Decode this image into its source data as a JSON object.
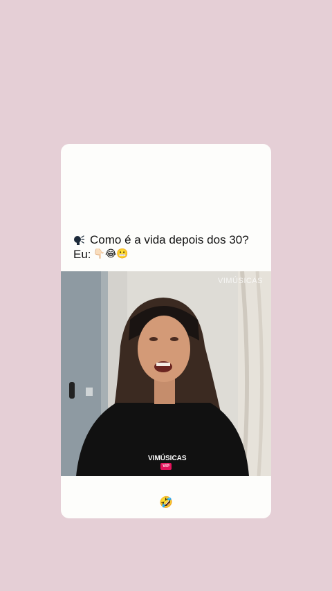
{
  "post": {
    "caption_line1": "Como é a vida depois dos 30?",
    "caption_line2_prefix": "Eu:",
    "caption_line2_emojis": "👇🏻😂😬",
    "caption_icon": "speaking-head-icon",
    "footer_emoji": "🤣"
  },
  "video": {
    "watermark": "VIMÚSICAS",
    "logo": "VIMÚSICAS",
    "logo_sub": "VIP"
  },
  "colors": {
    "background": "#e5cfd6",
    "card": "#fdfdfb"
  }
}
